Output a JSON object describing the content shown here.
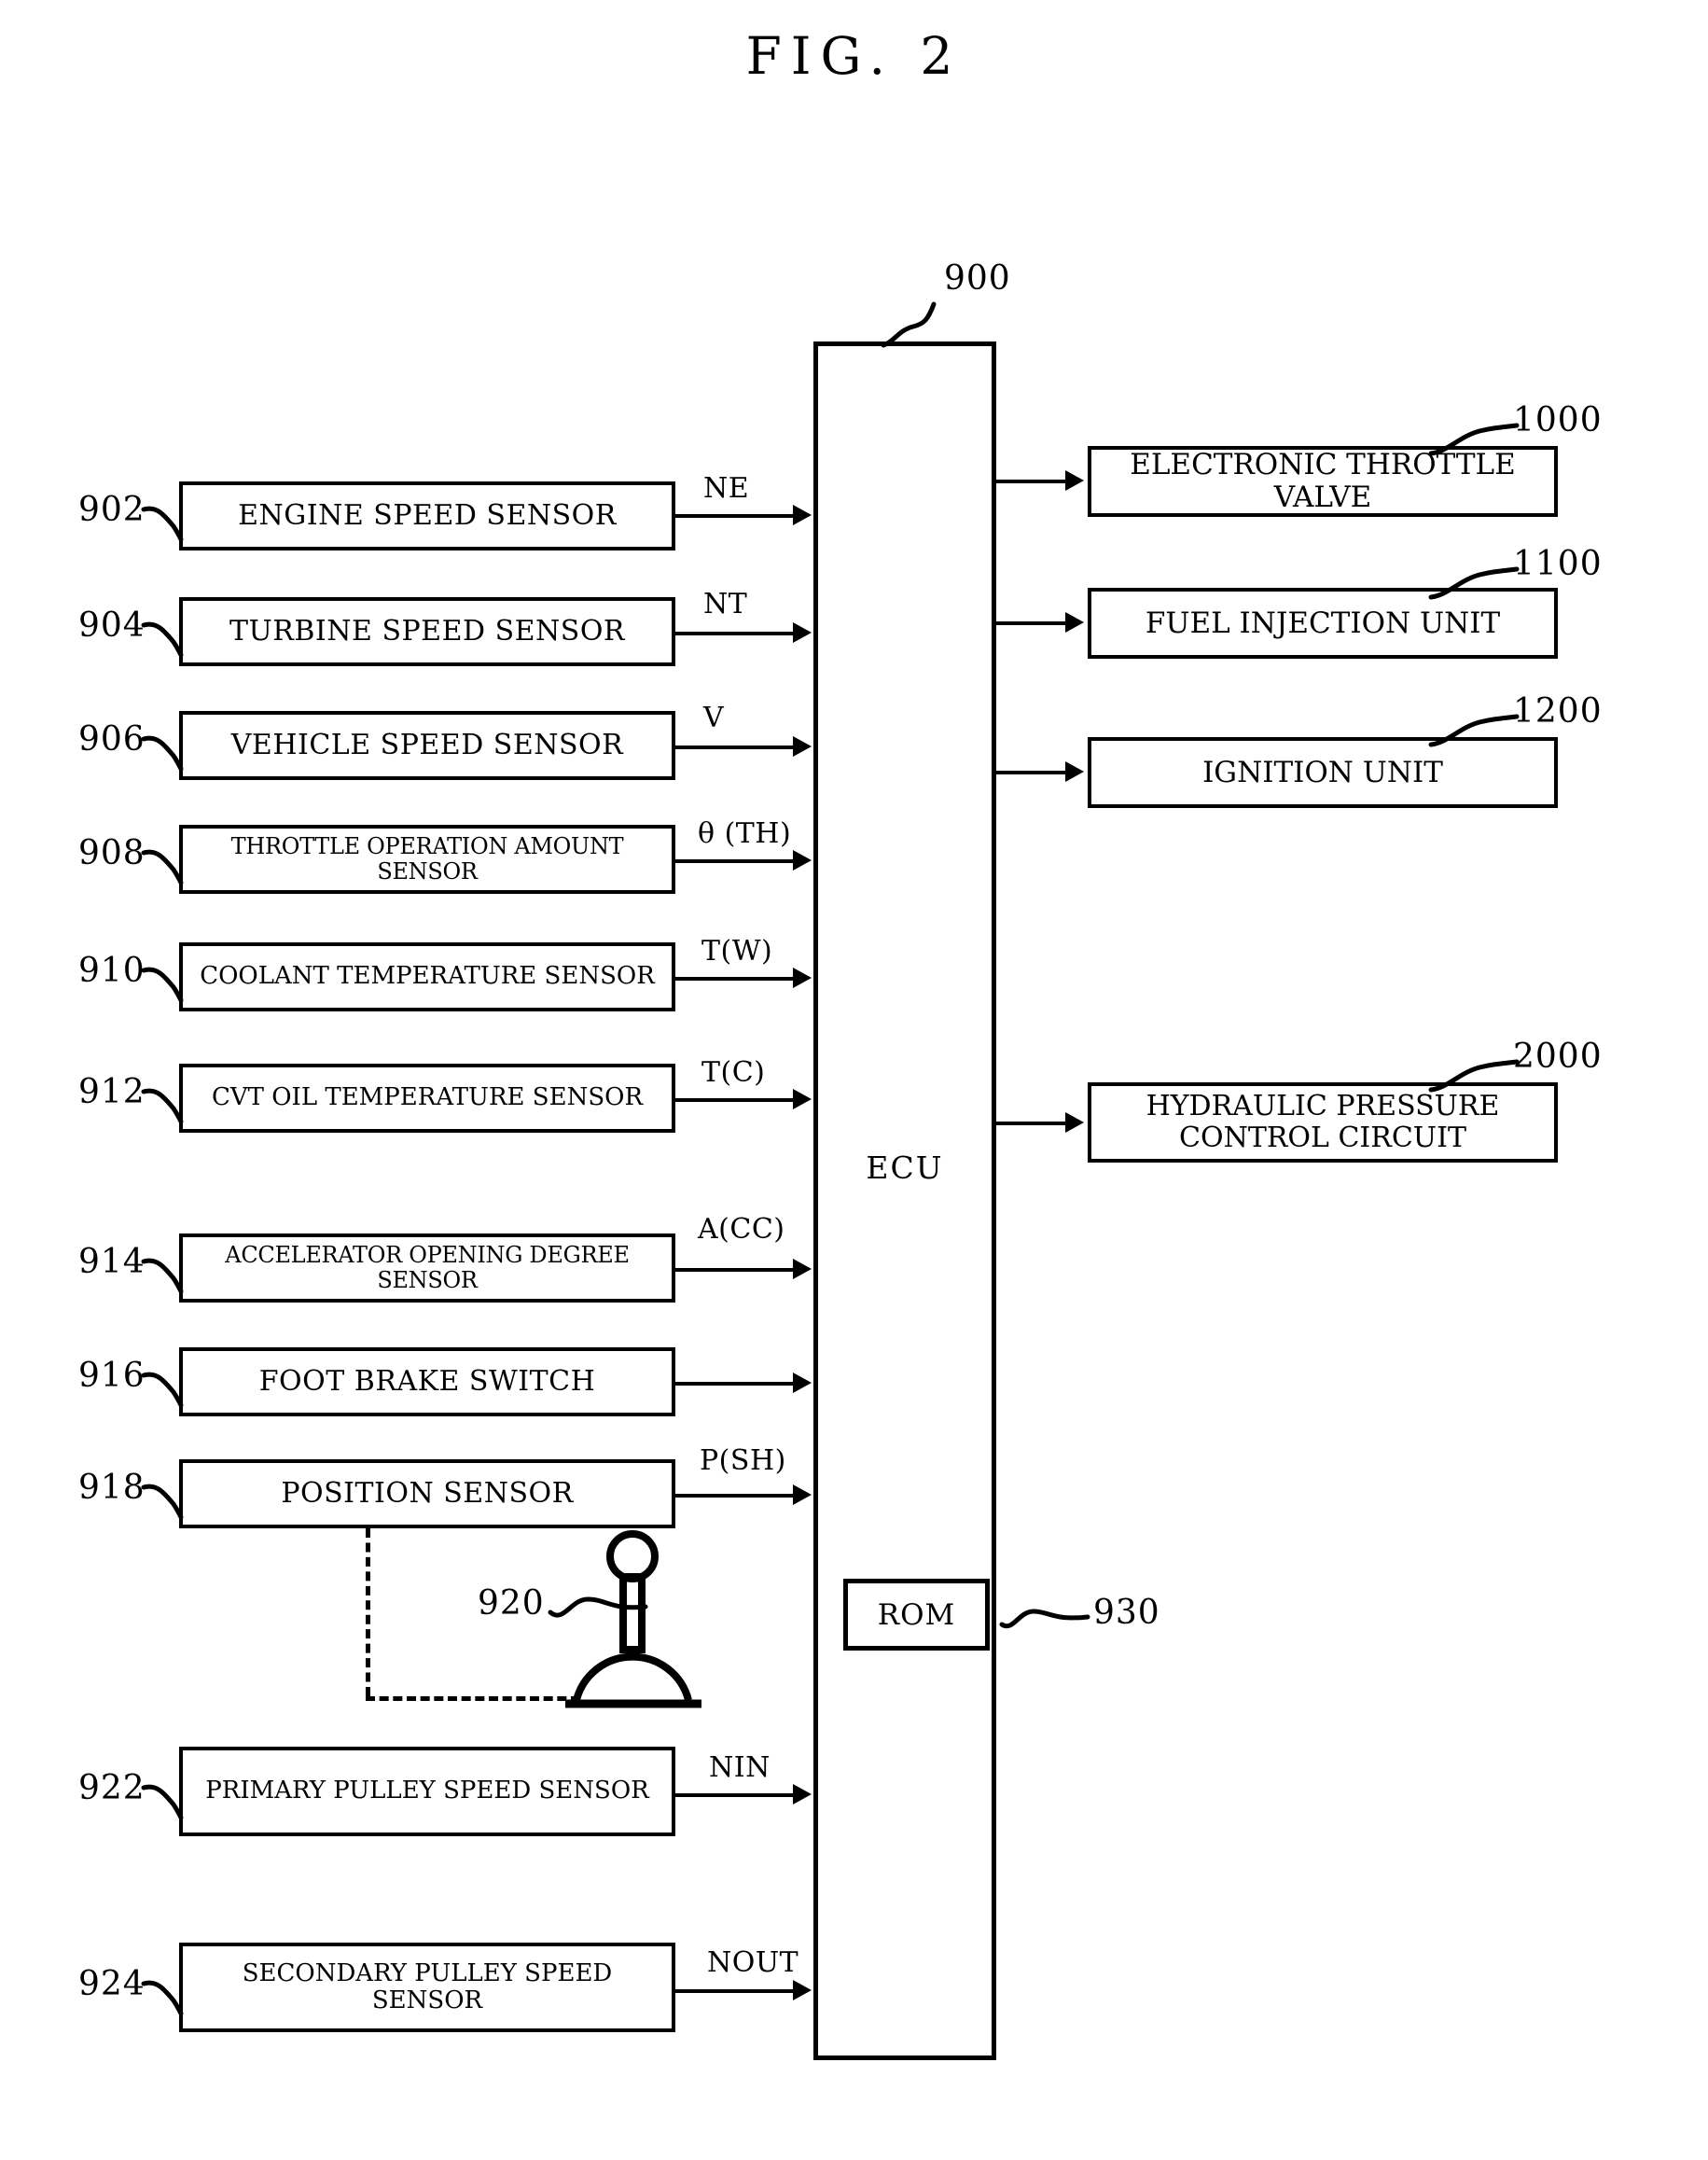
{
  "figure": {
    "title": "FIG. 2"
  },
  "ecu": {
    "label": "ECU",
    "ref": "900",
    "rom": {
      "label": "ROM",
      "ref": "930"
    }
  },
  "shift_lever": {
    "ref": "920",
    "icon": "shift-lever-icon"
  },
  "sensors": [
    {
      "ref": "902",
      "label": "ENGINE SPEED SENSOR",
      "signal": "NE"
    },
    {
      "ref": "904",
      "label": "TURBINE SPEED SENSOR",
      "signal": "NT"
    },
    {
      "ref": "906",
      "label": "VEHICLE SPEED SENSOR",
      "signal": "V"
    },
    {
      "ref": "908",
      "label": "THROTTLE OPERATION AMOUNT SENSOR",
      "signal": "θ (TH)"
    },
    {
      "ref": "910",
      "label": "COOLANT TEMPERATURE SENSOR",
      "signal": "T(W)"
    },
    {
      "ref": "912",
      "label": "CVT OIL TEMPERATURE SENSOR",
      "signal": "T(C)"
    },
    {
      "ref": "914",
      "label": "ACCELERATOR OPENING DEGREE SENSOR",
      "signal": "A(CC)"
    },
    {
      "ref": "916",
      "label": "FOOT BRAKE SWITCH",
      "signal": ""
    },
    {
      "ref": "918",
      "label": "POSITION SENSOR",
      "signal": "P(SH)"
    },
    {
      "ref": "922",
      "label": "PRIMARY PULLEY SPEED SENSOR",
      "signal": "NIN"
    },
    {
      "ref": "924",
      "label": "SECONDARY PULLEY SPEED SENSOR",
      "signal": "NOUT"
    }
  ],
  "outputs": [
    {
      "ref": "1000",
      "label": "ELECTRONIC THROTTLE VALVE"
    },
    {
      "ref": "1100",
      "label": "FUEL INJECTION UNIT"
    },
    {
      "ref": "1200",
      "label": "IGNITION UNIT"
    },
    {
      "ref": "2000",
      "label_line1": "HYDRAULIC PRESSURE",
      "label_line2": "CONTROL CIRCUIT"
    }
  ]
}
